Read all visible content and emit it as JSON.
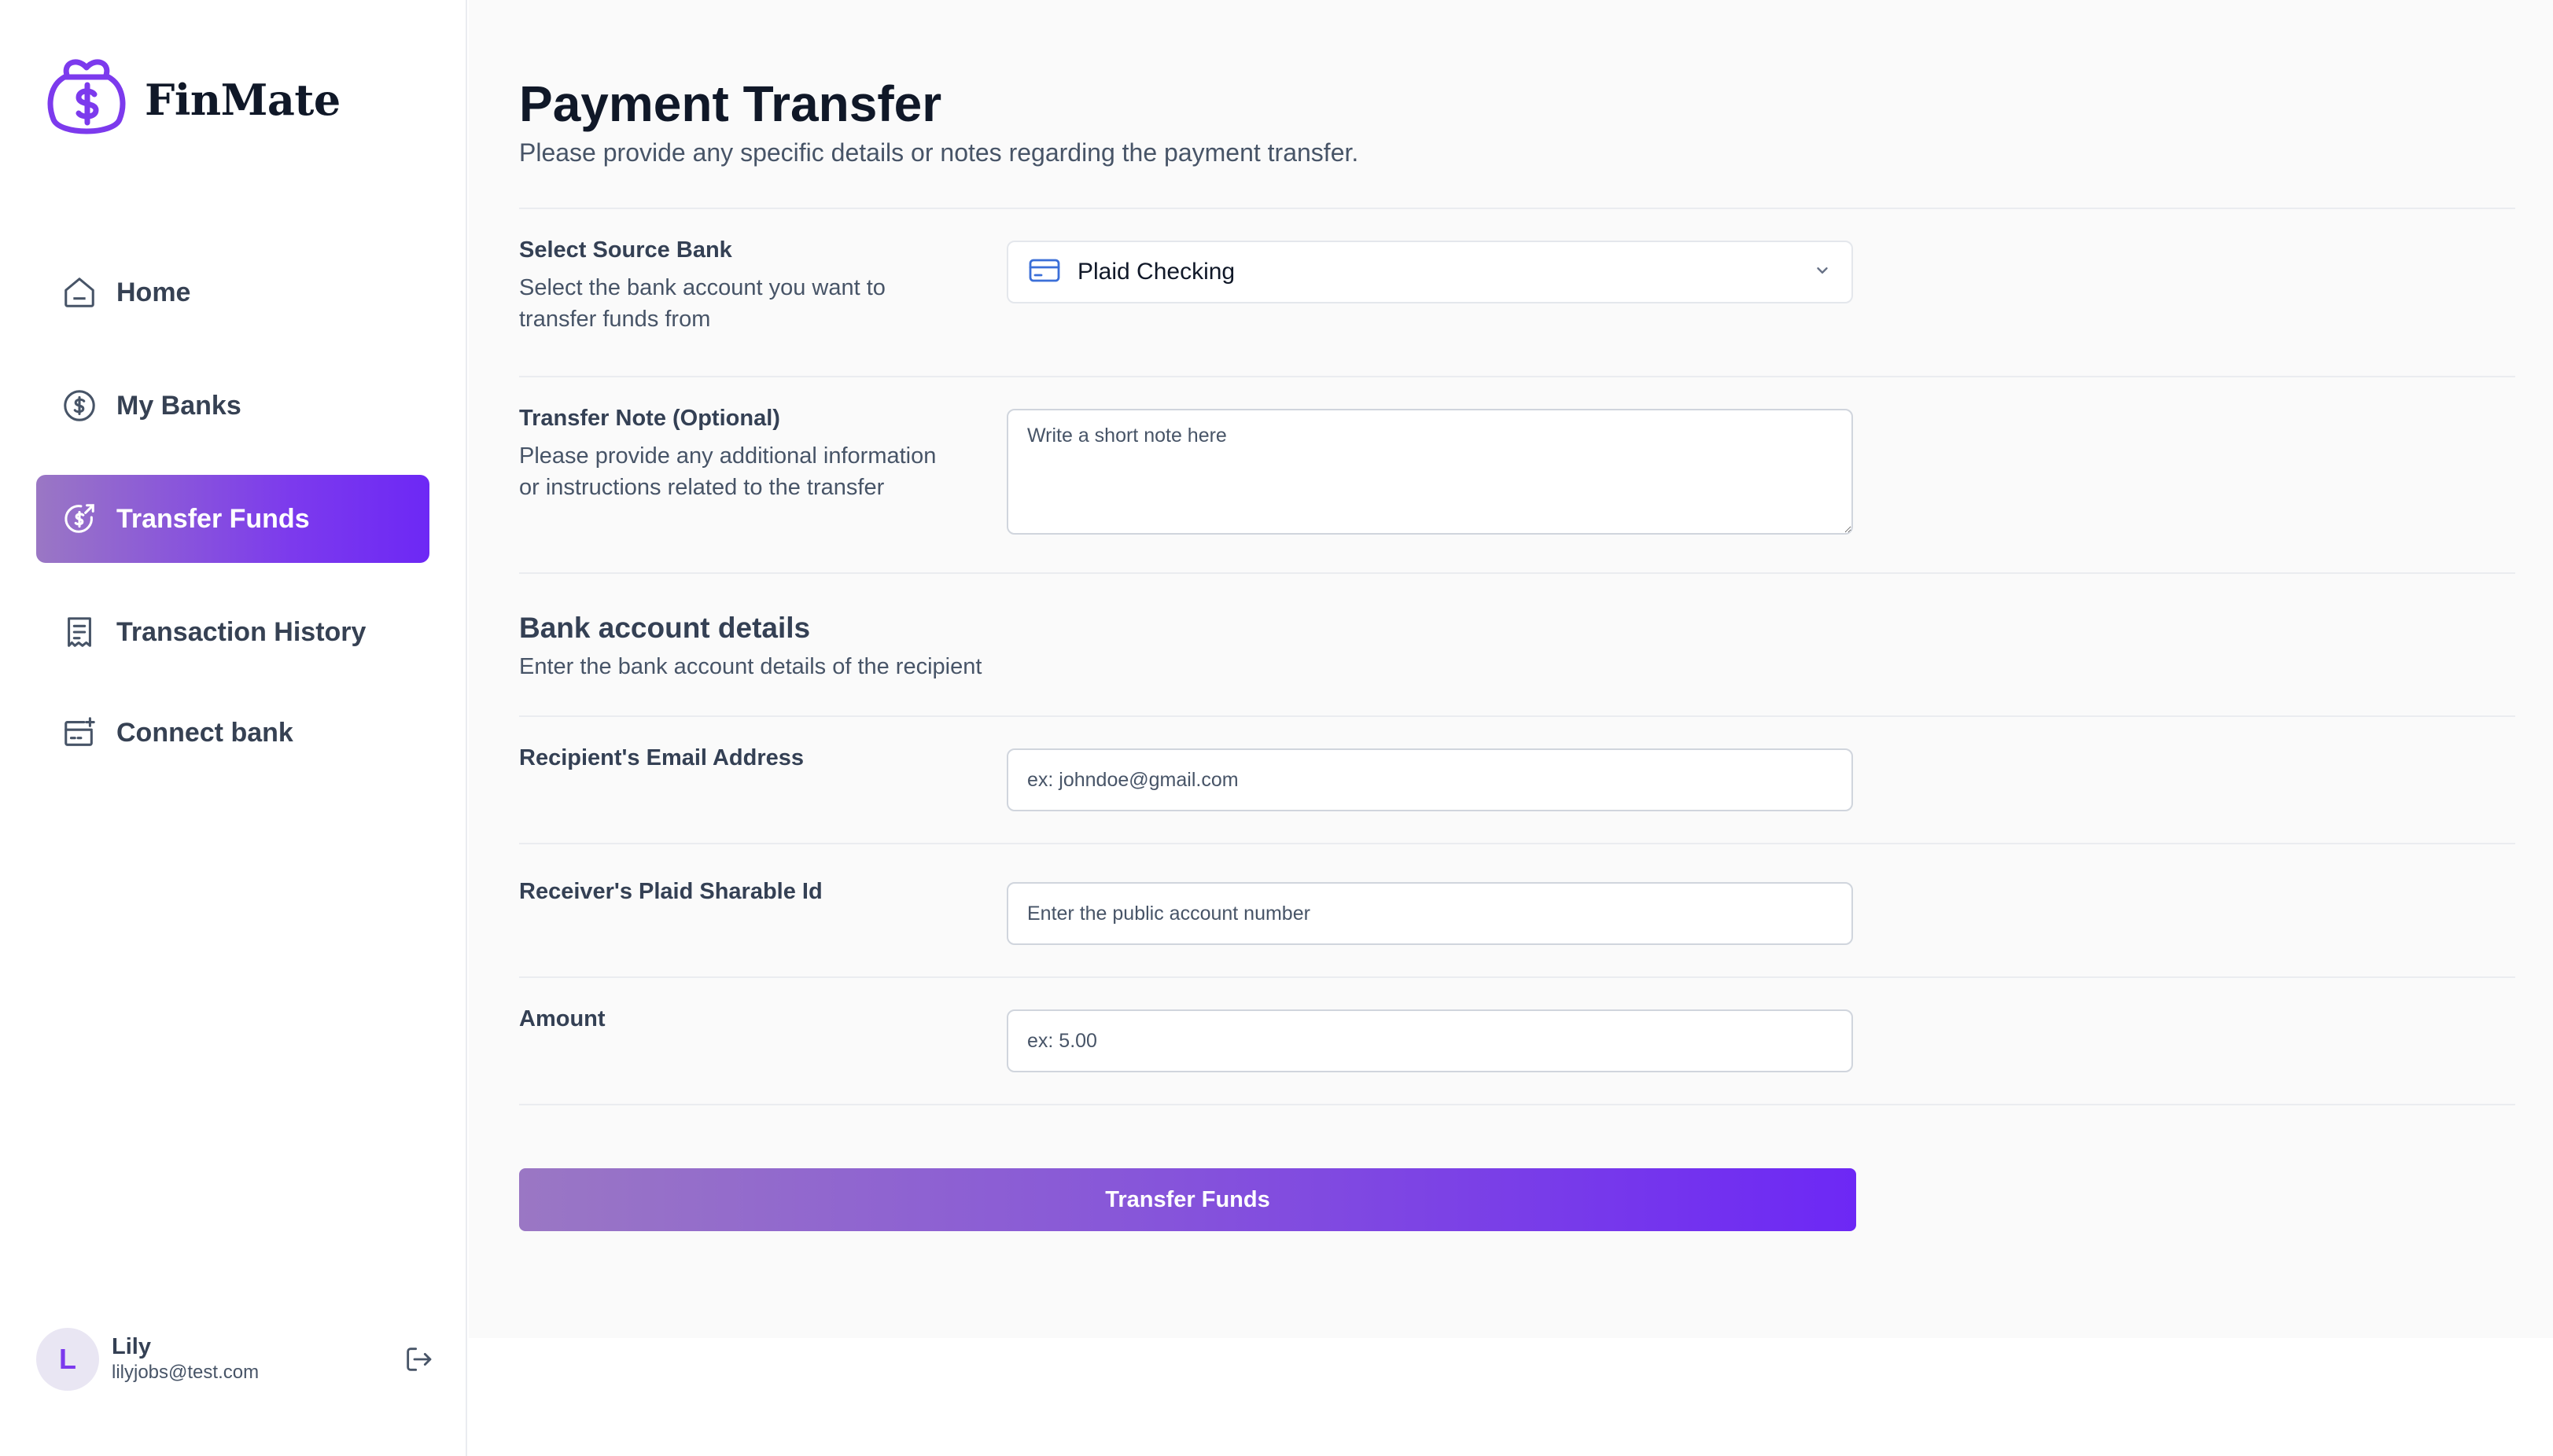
{
  "app": {
    "name": "FinMate",
    "logo_icon": "wallet-dollar-icon",
    "brand_color": "#7c3aed"
  },
  "sidebar": {
    "items": [
      {
        "label": "Home",
        "icon": "home-icon",
        "active": false
      },
      {
        "label": "My Banks",
        "icon": "dollar-circle-icon",
        "active": false
      },
      {
        "label": "Transfer Funds",
        "icon": "transfer-dollar-icon",
        "active": true
      },
      {
        "label": "Transaction History",
        "icon": "receipt-icon",
        "active": false
      },
      {
        "label": "Connect bank",
        "icon": "card-add-icon",
        "active": false
      }
    ]
  },
  "user": {
    "initial": "L",
    "name": "Lily",
    "email": "lilyjobs@test.com",
    "logout_icon": "logout-icon"
  },
  "page": {
    "title": "Payment Transfer",
    "subtitle": "Please provide any specific details or notes regarding the payment transfer."
  },
  "form": {
    "source_bank": {
      "label": "Select Source Bank",
      "description": "Select the bank account you want to transfer funds from",
      "value": "Plaid Checking",
      "icon": "credit-card-icon"
    },
    "note": {
      "label": "Transfer Note (Optional)",
      "description": "Please provide any additional information or instructions related to the transfer",
      "placeholder": "Write a short note here"
    },
    "bank_details": {
      "title": "Bank account details",
      "subtitle": "Enter the bank account details of the recipient"
    },
    "email": {
      "label": "Recipient's Email Address",
      "placeholder": "ex: johndoe@gmail.com"
    },
    "sharable_id": {
      "label": "Receiver's Plaid Sharable Id",
      "placeholder": "Enter the public account number"
    },
    "amount": {
      "label": "Amount",
      "placeholder": "ex: 5.00"
    },
    "submit_label": "Transfer Funds"
  }
}
